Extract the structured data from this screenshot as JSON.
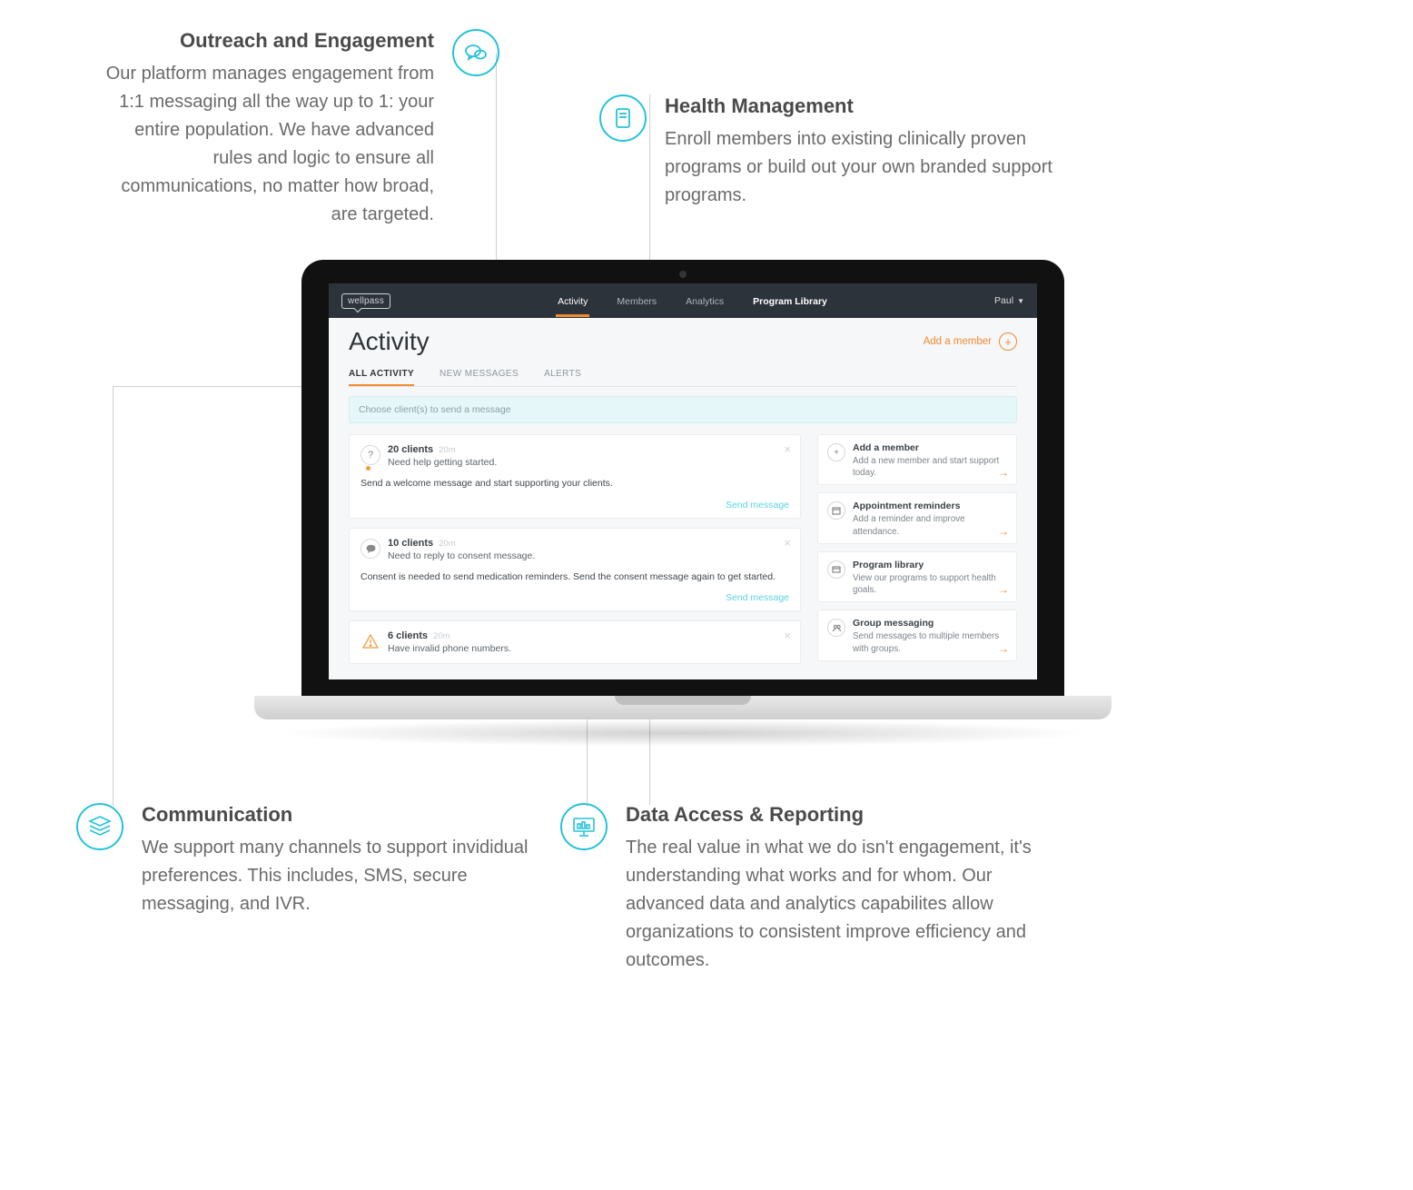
{
  "features": {
    "outreach": {
      "title": "Outreach and Engagement",
      "body": "Our platform manages engagement from 1:1 messaging all the way up to 1: your entire population. We have advanced rules and logic to ensure all communications, no matter how broad, are targeted.",
      "icon": "chat-bubbles-icon"
    },
    "health": {
      "title": "Health Management",
      "body": "Enroll members into existing clinically proven programs or build out your own branded support programs.",
      "icon": "clipboard-icon"
    },
    "communication": {
      "title": "Communication",
      "body": "We support many channels to support invididual preferences. This includes, SMS, secure messaging, and IVR.",
      "icon": "layers-icon"
    },
    "data": {
      "title": "Data Access & Reporting",
      "body": "The real value in what we do isn't engagement, it's understanding what works and for whom. Our advanced data and analytics capabilites allow organizations to consistent improve efficiency and outcomes.",
      "icon": "presentation-icon"
    }
  },
  "app": {
    "brand": "wellpass",
    "nav": {
      "activity": "Activity",
      "members": "Members",
      "analytics": "Analytics",
      "program_library": "Program Library"
    },
    "user_name": "Paul",
    "page_title": "Activity",
    "add_member_label": "Add a member",
    "tabs": {
      "all": "ALL ACTIVITY",
      "new_messages": "NEW MESSAGES",
      "alerts": "ALERTS"
    },
    "choose_placeholder": "Choose client(s) to send a message",
    "cards": [
      {
        "icon": "question-icon",
        "has_dot": true,
        "count": "20 clients",
        "time": "20m",
        "subtitle": "Need help getting started.",
        "body": "Send a welcome message and start supporting your clients.",
        "action": "Send message"
      },
      {
        "icon": "message-icon",
        "has_dot": false,
        "count": "10 clients",
        "time": "20m",
        "subtitle": "Need to reply to consent message.",
        "body": "Consent is needed to send medication reminders. Send the consent message again to get started.",
        "action": "Send message"
      },
      {
        "icon": "warning-icon",
        "has_dot": false,
        "count": "6 clients",
        "time": "20m",
        "subtitle": "Have invalid phone numbers.",
        "body": "",
        "action": ""
      }
    ],
    "rcards": [
      {
        "icon": "plus-icon",
        "title": "Add a member",
        "desc": "Add a new member and start support today."
      },
      {
        "icon": "calendar-icon",
        "title": "Appointment reminders",
        "desc": "Add a reminder and improve attendance."
      },
      {
        "icon": "box-icon",
        "title": "Program library",
        "desc": "View our programs to support health goals."
      },
      {
        "icon": "group-icon",
        "title": "Group messaging",
        "desc": "Send messages to multiple members with groups."
      }
    ]
  }
}
